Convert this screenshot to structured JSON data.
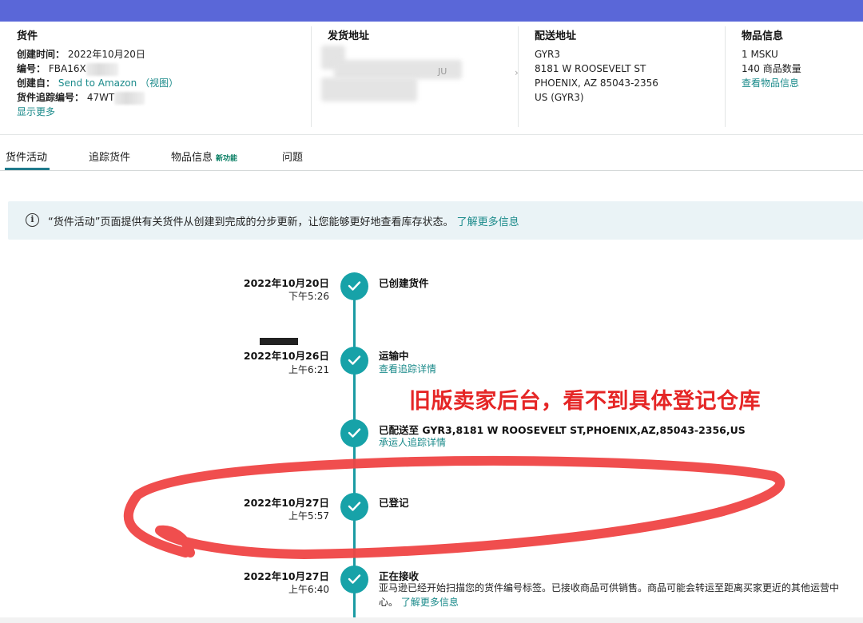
{
  "shipment": {
    "title": "货件",
    "created_label": "创建时间：",
    "created_value": "2022年10月20日",
    "id_label": "编号：",
    "id_value": "FBA16X",
    "creator_label": "创建自：",
    "creator_value": "Send to Amazon",
    "creator_link": "（视图）",
    "tracking_label": "货件追踪编号：",
    "tracking_value": "47WT",
    "show_more": "显示更多"
  },
  "ship_from": {
    "title": "发货地址",
    "fragment": "JU"
  },
  "ship_to": {
    "title": "配送地址",
    "lines": [
      "GYR3",
      "8181 W ROOSEVELT ST",
      "PHOENIX, AZ 85043-2356",
      "US (GYR3)"
    ]
  },
  "items": {
    "title": "物品信息",
    "msku": "1 MSKU",
    "quantity": "140 商品数量",
    "view_link": "查看物品信息"
  },
  "tabs": [
    {
      "label": "货件活动"
    },
    {
      "label": "追踪货件"
    },
    {
      "label": "物品信息",
      "badge": "新功能"
    },
    {
      "label": "问题"
    }
  ],
  "notice": {
    "icon": "info-icon",
    "text": "“货件活动”页面提供有关货件从创建到完成的分步更新，让您能够更好地查看库存状态。",
    "link": "了解更多信息"
  },
  "timeline": [
    {
      "date": "2022年10月20日",
      "time": "下午5:26",
      "event": "已创建货件"
    },
    {
      "date": "2022年10月26日",
      "time": "上午6:21",
      "event": "运输中",
      "link": "查看追踪详情"
    },
    {
      "event": "已配送至 GYR3,8181 W ROOSEVELT ST,PHOENIX,AZ,85043-2356,US",
      "link": "承运人追踪详情"
    },
    {
      "date": "2022年10月27日",
      "time": "上午5:57",
      "event": "已登记"
    },
    {
      "date": "2022年10月27日",
      "time": "上午6:40",
      "event": "正在接收",
      "desc": "亚马逊已经开始扫描您的货件编号标签。已接收商品可供销售。商品可能会转运至距离买家更近的其他运营中心。",
      "link": "了解更多信息"
    }
  ],
  "annotation": {
    "text": "旧版卖家后台，看不到具体登记仓库",
    "color": "#e52626"
  },
  "colors": {
    "accent": "#17a2a8",
    "link": "#1a8a8a",
    "topbar": "#5a67d8"
  }
}
